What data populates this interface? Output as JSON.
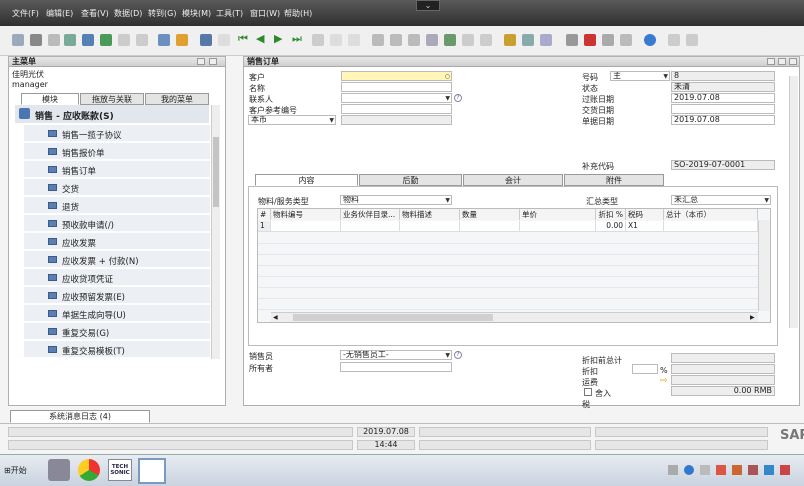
{
  "menu": [
    "文件(F)",
    "编辑(E)",
    "查看(V)",
    "数据(D)",
    "转到(G)",
    "模块(M)",
    "工具(T)",
    "窗口(W)",
    "帮助(H)"
  ],
  "main_menu": {
    "title": "主菜单",
    "company": "佳明光伏",
    "user": "manager",
    "tabs": [
      "模块",
      "拖放与关联",
      "我的菜单"
    ],
    "section": "销售 - 应收账款(S)",
    "items": [
      "销售一揽子协议",
      "销售报价单",
      "销售订单",
      "交货",
      "退货",
      "预收款申请(/)",
      "应收发票",
      "应收发票 + 付款(N)",
      "应收贷项凭证",
      "应收预留发票(E)",
      "单据生成向导(U)",
      "重复交易(G)",
      "重复交易模板(T)"
    ]
  },
  "order": {
    "title": "销售订单",
    "labels": {
      "customer": "客户",
      "name": "名称",
      "contact": "联系人",
      "ref": "客户参考编号",
      "currency": "本币",
      "number": "号码",
      "status": "状态",
      "posting_date": "过账日期",
      "delivery_date": "交货日期",
      "doc_date": "单据日期",
      "extra_code": "补充代码"
    },
    "values": {
      "series": "主",
      "number": "8",
      "status": "未清",
      "posting_date": "2019.07.08",
      "doc_date": "2019.07.08",
      "extra_code": "SO-2019-07-0001"
    },
    "tabs": [
      "内容",
      "后勤",
      "会计",
      "附件"
    ],
    "item_type_label": "物料/服务类型",
    "item_type_value": "物料",
    "summary_type_label": "汇总类型",
    "summary_type_value": "未汇总",
    "columns": [
      "#",
      "物料编号",
      "业务伙伴目录...",
      "物料描述",
      "数量",
      "单价",
      "折扣 %",
      "税码",
      "总计（本币）"
    ],
    "row1": {
      "num": "1",
      "discount": "0.00",
      "tax": "X1"
    },
    "bottom_labels": {
      "sales_employee": "销售员",
      "owner": "所有者",
      "before_discount": "折扣前总计",
      "discount": "折扣",
      "freight": "运费",
      "rounding": "舍入",
      "tax": "税"
    },
    "sales_employee_value": "-无销售员工-",
    "percent": "%",
    "tax_total": "0.00 RMB"
  },
  "messages_tab": "系统消息日志 (4)",
  "status": {
    "date": "2019.07.08",
    "time": "14:44"
  },
  "taskbar": {
    "start": "开始",
    "logo": "SAP",
    "app_label": "TECH SONIC"
  }
}
